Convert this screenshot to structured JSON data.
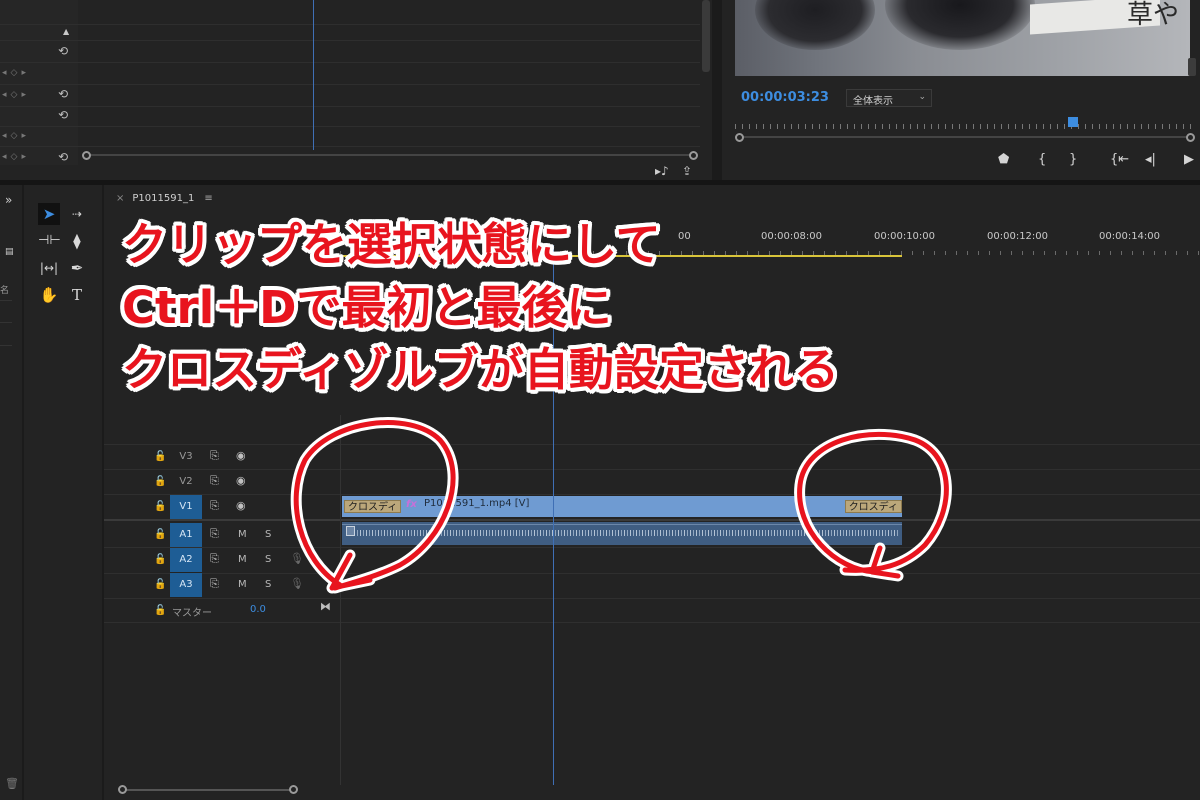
{
  "effect_controls": {
    "reset_icon": "reset-icon",
    "footer_icons": [
      "audio-filter-icon",
      "export-icon"
    ]
  },
  "monitor": {
    "timecode": "00:00:03:23",
    "zoom": "全体表示",
    "video_overlay_text": "草や",
    "transport": [
      "marker-icon",
      "in-point-icon",
      "out-point-icon",
      "go-to-in-icon",
      "step-back-icon",
      "play-icon"
    ]
  },
  "tools": [
    "selection-tool",
    "track-select-tool",
    "ripple-edit-tool",
    "razor-tool",
    "slip-tool",
    "pen-tool",
    "hand-tool",
    "type-tool"
  ],
  "timeline": {
    "sequence_name": "P1011591_1",
    "ruler_labels": [
      "00:00:08:00",
      "00:00:10:00",
      "00:00:12:00",
      "00:00:14:00"
    ],
    "ruler_partial": "00",
    "video_tracks": [
      {
        "name": "V3",
        "targeted": false
      },
      {
        "name": "V2",
        "targeted": false
      },
      {
        "name": "V1",
        "targeted": true
      }
    ],
    "audio_tracks": [
      {
        "name": "A1",
        "mute": "M",
        "solo": "S"
      },
      {
        "name": "A2",
        "mute": "M",
        "solo": "S"
      },
      {
        "name": "A3",
        "mute": "M",
        "solo": "S"
      }
    ],
    "master": {
      "label": "マスター",
      "value": "0.0"
    },
    "clip": {
      "name": "P1011591_1.mp4 [V]",
      "fx_badge": "fx",
      "transition_start": "クロスディ",
      "transition_end": "クロスディ"
    }
  },
  "annotation": {
    "line1": "クリップを選択状態にして",
    "line2": "Ctrl＋Dで最初と最後に",
    "line3": "クロスディゾルブが自動設定される",
    "color": "#e8141e"
  }
}
